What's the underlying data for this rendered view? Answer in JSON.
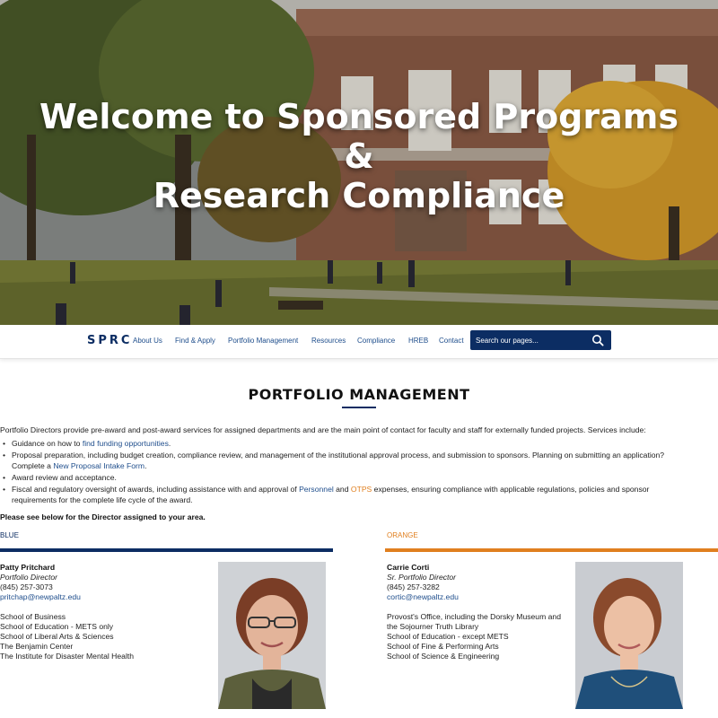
{
  "hero": {
    "title_line1": "Welcome to Sponsored Programs",
    "title_line2": "&",
    "title_line3": "Research Compliance"
  },
  "nav": {
    "brand": "SPRC",
    "links": [
      "About Us",
      "Find & Apply",
      "Portfolio Management",
      "Resources",
      "Compliance",
      "HREB",
      "Contact"
    ],
    "search_placeholder": "Search our pages...",
    "search_icon": "search-icon"
  },
  "main": {
    "title": "PORTFOLIO MANAGEMENT",
    "intro": "Portfolio Directors provide pre-award and post-award services for assigned departments and are the main point of contact for faculty and staff for externally funded projects. Services include:",
    "services": [
      {
        "pre": "Guidance on how to ",
        "link": "find funding opportunities",
        "post": "."
      },
      {
        "pre": "Proposal preparation, including budget creation, compliance review, and management of the institutional approval process, and submission to sponsors. Planning on submitting an application? Complete a ",
        "link": "New Proposal Intake Form",
        "post": "."
      },
      {
        "text": "Award review and acceptance."
      },
      {
        "pre": "Fiscal and regulatory oversight of awards, including assistance with and approval of ",
        "link1": "Personnel",
        "mid": " and ",
        "link2": "OTPS",
        "post": " expenses, ensuring compliance with applicable regulations, policies and sponsor requirements for the complete life cycle of the award."
      }
    ],
    "note": "Please see below for the Director assigned to your area."
  },
  "areas": {
    "blue": {
      "label": "BLUE",
      "color": "#0c2d63",
      "name": "Patty Pritchard",
      "role": "Portfolio Director",
      "phone": "(845) 257-3073",
      "email": "pritchap@newpaltz.edu",
      "units": [
        "School of Business",
        "School of Education - METS only",
        "School of Liberal Arts & Sciences",
        "The Benjamin Center",
        "The Institute for Disaster Mental Health"
      ]
    },
    "orange": {
      "label": "ORANGE",
      "color": "#e07f1f",
      "name": "Carrie Corti",
      "role": "Sr. Portfolio Director",
      "phone": "(845) 257-3282",
      "email": "cortic@newpaltz.edu",
      "units": [
        "Provost's Office, including the Dorsky Museum and",
        "the Sojourner Truth Library",
        "School of Education - except METS",
        "School of Fine & Performing Arts",
        "School of Science & Engineering"
      ]
    }
  }
}
